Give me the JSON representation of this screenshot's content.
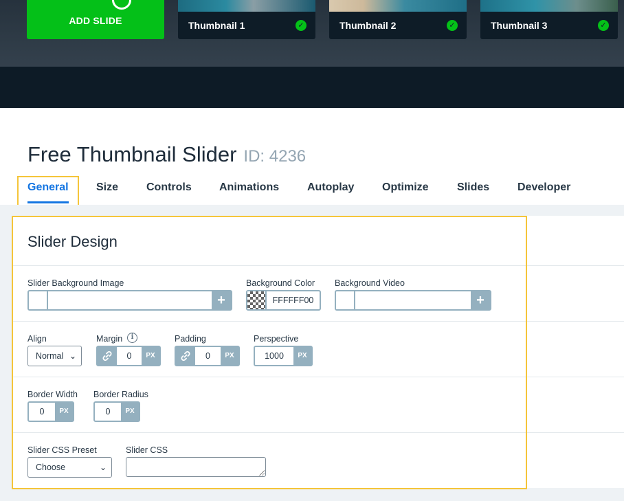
{
  "slides": {
    "add_label": "ADD SLIDE",
    "thumbnails": [
      {
        "label": "Thumbnail 1"
      },
      {
        "label": "Thumbnail 2"
      },
      {
        "label": "Thumbnail 3"
      }
    ],
    "check_glyph": "✓",
    "accent": "#04c018"
  },
  "header": {
    "title": "Free Thumbnail Slider",
    "id_text": "ID: 4236"
  },
  "tabs": [
    {
      "label": "General",
      "active": true
    },
    {
      "label": "Size"
    },
    {
      "label": "Controls"
    },
    {
      "label": "Animations"
    },
    {
      "label": "Autoplay"
    },
    {
      "label": "Optimize"
    },
    {
      "label": "Slides"
    },
    {
      "label": "Developer"
    }
  ],
  "panel": {
    "title": "Slider Design",
    "bg_image_label": "Slider Background Image",
    "bg_color_label": "Background Color",
    "bg_color_value": "FFFFFF00",
    "bg_video_label": "Background Video",
    "align_label": "Align",
    "align_value": "Normal",
    "margin_label": "Margin",
    "margin_value": "0",
    "padding_label": "Padding",
    "padding_value": "0",
    "perspective_label": "Perspective",
    "perspective_value": "1000",
    "border_width_label": "Border Width",
    "border_width_value": "0",
    "border_radius_label": "Border Radius",
    "border_radius_value": "0",
    "css_preset_label": "Slider CSS Preset",
    "css_preset_value": "Choose",
    "slider_css_label": "Slider CSS",
    "unit": "PX",
    "plus_glyph": "+",
    "chevron_glyph": "⌄",
    "info_glyph": "i"
  }
}
